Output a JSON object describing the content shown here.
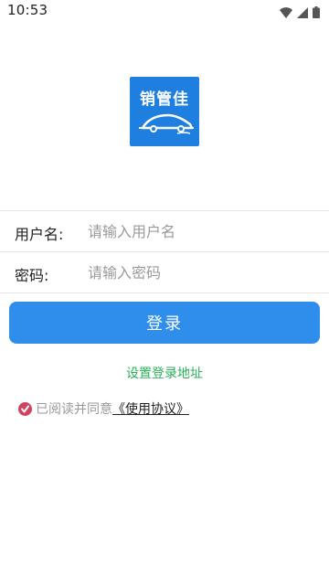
{
  "status_bar": {
    "time": "10:53",
    "icons": [
      "wifi-icon",
      "signal-icon",
      "battery-icon"
    ]
  },
  "logo": {
    "text": "销管佳",
    "color": "#1e7fe0"
  },
  "form": {
    "username": {
      "label": "用户名:",
      "placeholder": "请输入用户名",
      "value": ""
    },
    "password": {
      "label": "密码:",
      "placeholder": "请输入密码",
      "value": ""
    }
  },
  "login_button": {
    "label": "登录",
    "color": "#2f8eeb"
  },
  "set_server_link": {
    "label": "设置登录地址",
    "color": "#2bb15b"
  },
  "agreement": {
    "checked": true,
    "prefix": "已阅读并同意",
    "link": "《使用协议》",
    "check_color": "#d0435e"
  }
}
